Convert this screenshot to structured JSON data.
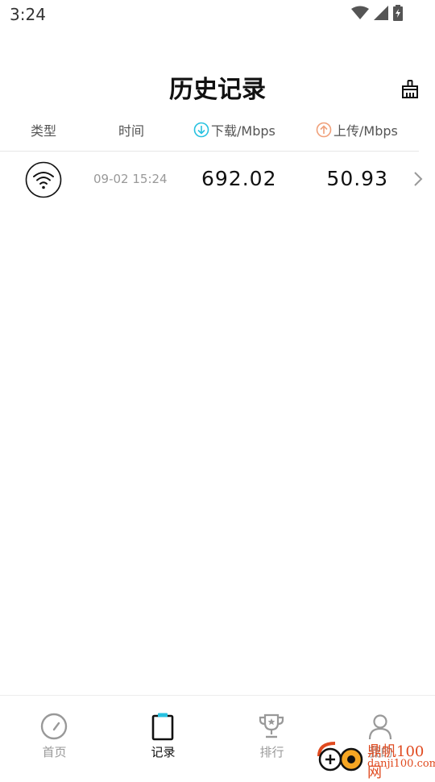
{
  "status_bar": {
    "time": "3:24"
  },
  "header": {
    "title": "历史记录"
  },
  "columns": {
    "type": "类型",
    "time": "时间",
    "download": "下载/Mbps",
    "upload": "上传/Mbps"
  },
  "records": [
    {
      "time": "09-02 15:24",
      "download": "692.02",
      "upload": "50.93",
      "type_icon": "wifi-icon"
    }
  ],
  "colors": {
    "download_accent": "#27c1e0",
    "upload_accent": "#f0a07a",
    "active_nav": "#111111",
    "inactive_nav": "#999999"
  },
  "bottom_nav": {
    "items": [
      {
        "label": "首页",
        "icon": "speedometer-icon"
      },
      {
        "label": "记录",
        "icon": "clipboard-icon",
        "active": true
      },
      {
        "label": "排行",
        "icon": "trophy-icon"
      },
      {
        "label": "我的",
        "icon": "person-icon"
      }
    ]
  },
  "watermark": {
    "cn": "鼎帆100网",
    "en": "danji100.com"
  }
}
